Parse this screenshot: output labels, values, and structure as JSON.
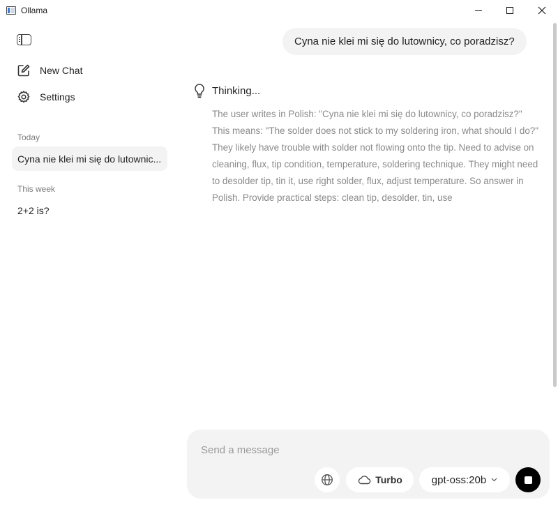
{
  "window": {
    "title": "Ollama"
  },
  "sidebar": {
    "new_chat_label": "New Chat",
    "settings_label": "Settings",
    "today_label": "Today",
    "this_week_label": "This week",
    "today_chats": [
      "Cyna nie klei mi się do lutownic..."
    ],
    "week_chats": [
      "2+2 is?"
    ]
  },
  "conversation": {
    "user_message": "Cyna nie klei mi się do lutownicy, co poradzisz?",
    "thinking_label": "Thinking...",
    "thinking_text": "The user writes in Polish: \"Cyna nie klei mi się do lutownicy, co poradzisz?\" This means: \"The solder does not stick to my soldering iron, what should I do?\" They likely have trouble with solder not flowing onto the tip. Need to advise on cleaning, flux, tip condition, temperature, soldering technique. They might need to desolder tip, tin it, use right solder, flux, adjust temperature. So answer in Polish. Provide practical steps: clean tip, desolder, tin, use"
  },
  "composer": {
    "placeholder": "Send a message",
    "value": "",
    "turbo_label": "Turbo",
    "model_label": "gpt-oss:20b"
  },
  "icons": {
    "sidebar_toggle": "sidebar-toggle-icon",
    "new_chat": "edit-icon",
    "settings": "gear-icon",
    "thinking": "lightbulb-icon",
    "web_search": "globe-icon",
    "turbo": "cloud-icon",
    "model_dropdown": "chevron-down-icon",
    "stop": "stop-icon"
  },
  "colors": {
    "bubble_bg": "#f3f3f3",
    "thinking_text": "#8a8a8a",
    "stop_button": "#000000"
  }
}
